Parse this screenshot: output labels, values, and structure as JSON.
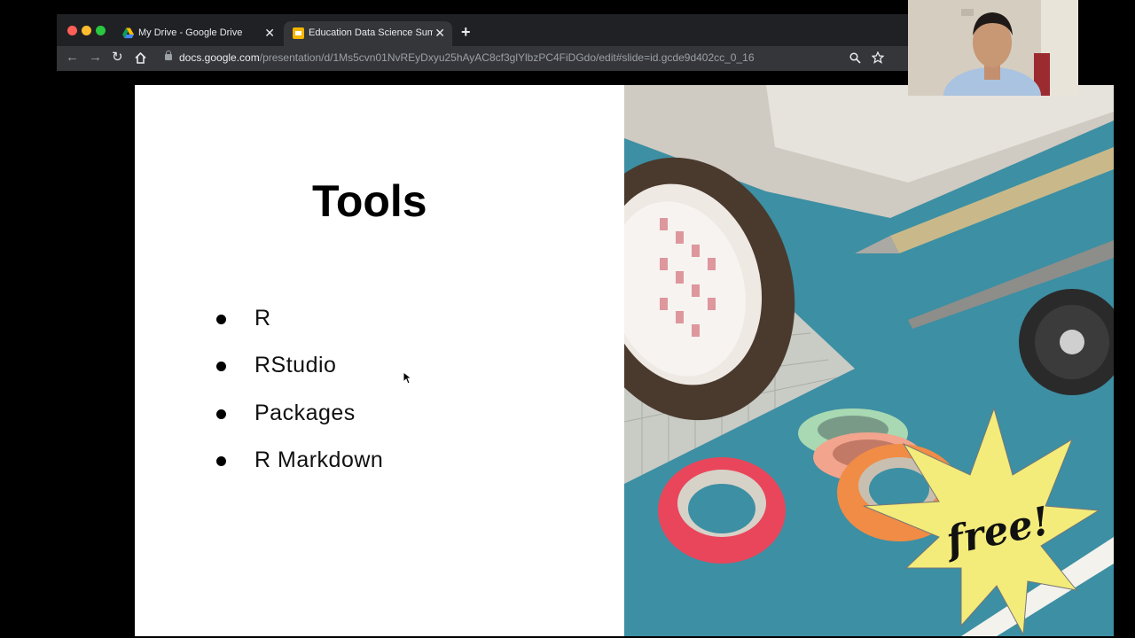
{
  "browser": {
    "tabs": [
      {
        "label": "My Drive - Google Drive",
        "active": false
      },
      {
        "label": "Education Data Science Summ",
        "active": true
      }
    ],
    "close_glyph": "✕",
    "new_tab_glyph": "+",
    "url_host": "docs.google.com",
    "url_path": "/presentation/d/1Ms5cvn01NvREyDxyu25hAyAC8cf3glYlbzPC4FiDGdo/edit#slide=id.gcde9d402cc_0_16"
  },
  "slide": {
    "title": "Tools",
    "bullets": [
      "R",
      "RStudio",
      "Packages",
      "R Markdown"
    ],
    "starburst_text": "free!"
  },
  "colors": {
    "browser_chrome": "#202124",
    "toolbar": "#35363a",
    "starburst": "#f3ec7a",
    "cutting_mat": "#3d8fa3"
  }
}
